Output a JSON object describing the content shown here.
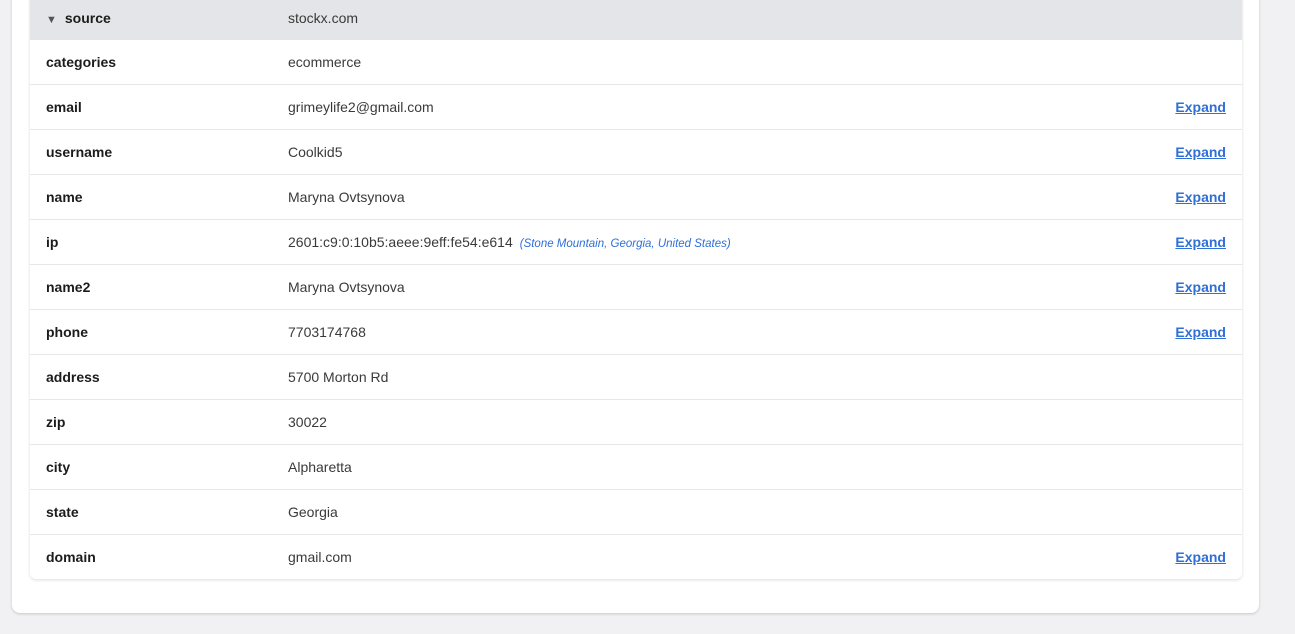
{
  "record": {
    "header": {
      "key": "source",
      "value": "stockx.com"
    },
    "rows": [
      {
        "key": "categories",
        "value": "ecommerce",
        "geo": "",
        "expand": ""
      },
      {
        "key": "email",
        "value": "grimeylife2@gmail.com",
        "geo": "",
        "expand": "Expand"
      },
      {
        "key": "username",
        "value": "Coolkid5",
        "geo": "",
        "expand": "Expand"
      },
      {
        "key": "name",
        "value": "Maryna Ovtsynova",
        "geo": "",
        "expand": "Expand"
      },
      {
        "key": "ip",
        "value": "2601:c9:0:10b5:aeee:9eff:fe54:e614",
        "geo": "(Stone Mountain, Georgia, United States)",
        "expand": "Expand"
      },
      {
        "key": "name2",
        "value": "Maryna Ovtsynova",
        "geo": "",
        "expand": "Expand"
      },
      {
        "key": "phone",
        "value": "7703174768",
        "geo": "",
        "expand": "Expand"
      },
      {
        "key": "address",
        "value": "5700 Morton Rd",
        "geo": "",
        "expand": ""
      },
      {
        "key": "zip",
        "value": "30022",
        "geo": "",
        "expand": ""
      },
      {
        "key": "city",
        "value": "Alpharetta",
        "geo": "",
        "expand": ""
      },
      {
        "key": "state",
        "value": "Georgia",
        "geo": "",
        "expand": ""
      },
      {
        "key": "domain",
        "value": "gmail.com",
        "geo": "",
        "expand": "Expand"
      }
    ]
  },
  "icons": {
    "collapse": "caret-down-icon"
  },
  "colors": {
    "link": "#2f6fd6",
    "header_bg": "#e4e5e8",
    "page_bg": "#f1f1f3"
  }
}
